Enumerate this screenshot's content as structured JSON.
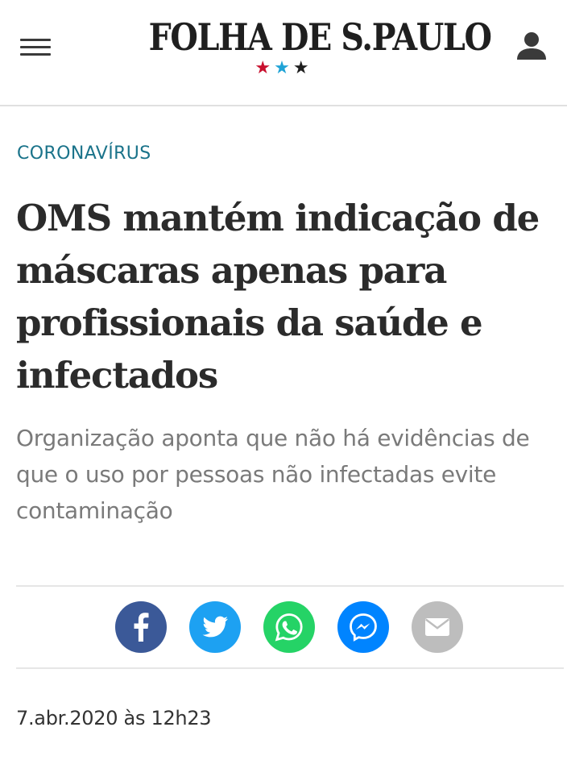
{
  "header": {
    "logo_text": "FOLHA DE S.PAULO",
    "stars": [
      "★",
      "★",
      "★"
    ],
    "star_colors": [
      "#c8102e",
      "#1fa3d6",
      "#1f1f1f"
    ]
  },
  "article": {
    "section": "CORONAVÍRUS",
    "headline": "OMS mantém indicação de máscaras apenas para profissionais da saúde e infectados",
    "subheadline": "Organização aponta que não há evidências de que o uso por pessoas não infectadas evite contaminação",
    "date": "7.abr.2020 às 12h23"
  },
  "share": {
    "buttons": [
      {
        "icon": "facebook-icon",
        "color": "#3b5998"
      },
      {
        "icon": "twitter-icon",
        "color": "#1da1f2"
      },
      {
        "icon": "whatsapp-icon",
        "color": "#25d366"
      },
      {
        "icon": "messenger-icon",
        "color": "#0084ff"
      },
      {
        "icon": "email-icon",
        "color": "#bdbdbd"
      }
    ]
  },
  "colors": {
    "kicker": "#1a738a",
    "headline": "#2b2b2b",
    "subheadline": "#7a7a7a"
  }
}
